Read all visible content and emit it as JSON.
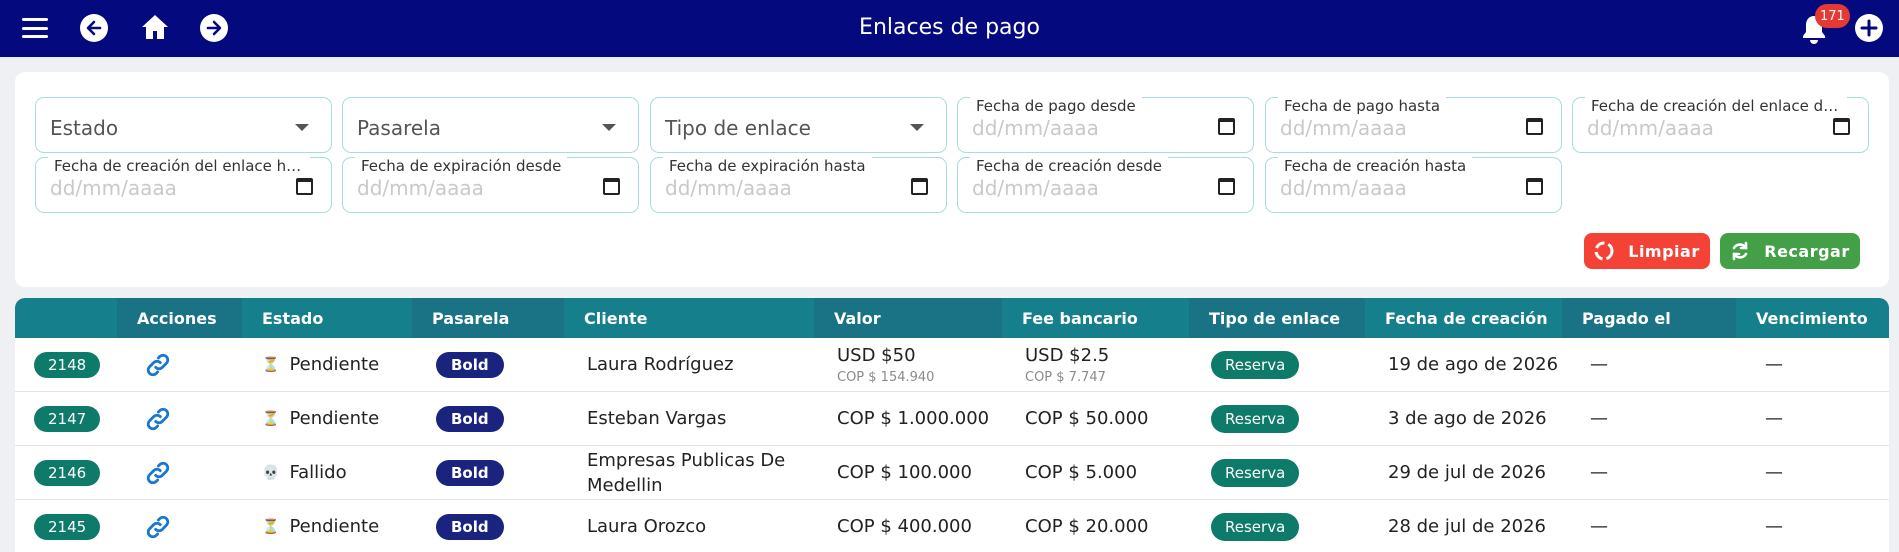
{
  "header": {
    "title": "Enlaces de pago",
    "notifications_count": "171",
    "icons": [
      "menu-icon",
      "back-arrow-icon",
      "home-icon",
      "forward-arrow-icon",
      "bell-icon",
      "plus-icon"
    ]
  },
  "filters": {
    "selects": [
      {
        "placeholder": "Estado"
      },
      {
        "placeholder": "Pasarela"
      },
      {
        "placeholder": "Tipo de enlace"
      }
    ],
    "dates": [
      {
        "label": "Fecha de pago desde",
        "value": "dd/mm/aaaa"
      },
      {
        "label": "Fecha de pago hasta",
        "value": "dd/mm/aaaa"
      },
      {
        "label": "Fecha de creación del enlace desde",
        "value": "dd/mm/aaaa"
      },
      {
        "label": "Fecha de creación del enlace hasta",
        "value": "dd/mm/aaaa"
      },
      {
        "label": "Fecha de expiración desde",
        "value": "dd/mm/aaaa"
      },
      {
        "label": "Fecha de expiración hasta",
        "value": "dd/mm/aaaa"
      },
      {
        "label": "Fecha de creación desde",
        "value": "dd/mm/aaaa"
      },
      {
        "label": "Fecha de creación hasta",
        "value": "dd/mm/aaaa"
      }
    ],
    "clear_label": "Limpiar",
    "reload_label": "Recargar"
  },
  "table": {
    "columns": [
      "",
      "Acciones",
      "Estado",
      "Pasarela",
      "Cliente",
      "Valor",
      "Fee bancario",
      "Tipo de enlace",
      "Fecha de creación",
      "Pagado el",
      "Vencimiento"
    ],
    "rows": [
      {
        "id": "2148",
        "status": "Pendiente",
        "status_icon": "⏳",
        "gateway": "Bold",
        "client": "Laura Rodríguez",
        "value": "USD $50",
        "value_sub": "COP $ 154.940",
        "fee": "USD $2.5",
        "fee_sub": "COP $ 7.747",
        "type": "Reserva",
        "created": "19 de ago de 2026",
        "paid": "—",
        "expires": "—"
      },
      {
        "id": "2147",
        "status": "Pendiente",
        "status_icon": "⏳",
        "gateway": "Bold",
        "client": "Esteban Vargas",
        "value": "COP $ 1.000.000",
        "value_sub": "",
        "fee": "COP $ 50.000",
        "fee_sub": "",
        "type": "Reserva",
        "created": "3 de ago de 2026",
        "paid": "—",
        "expires": "—"
      },
      {
        "id": "2146",
        "status": "Fallido",
        "status_icon": "💀",
        "gateway": "Bold",
        "client": "Empresas Publicas De Medellin",
        "value": "COP $ 100.000",
        "value_sub": "",
        "fee": "COP $ 5.000",
        "fee_sub": "",
        "type": "Reserva",
        "created": "29 de jul de 2026",
        "paid": "—",
        "expires": "—"
      },
      {
        "id": "2145",
        "status": "Pendiente",
        "status_icon": "⏳",
        "gateway": "Bold",
        "client": "Laura Orozco",
        "value": "COP $ 400.000",
        "value_sub": "",
        "fee": "COP $ 20.000",
        "fee_sub": "",
        "type": "Reserva",
        "created": "28 de jul de 2026",
        "paid": "—",
        "expires": "—"
      }
    ]
  }
}
